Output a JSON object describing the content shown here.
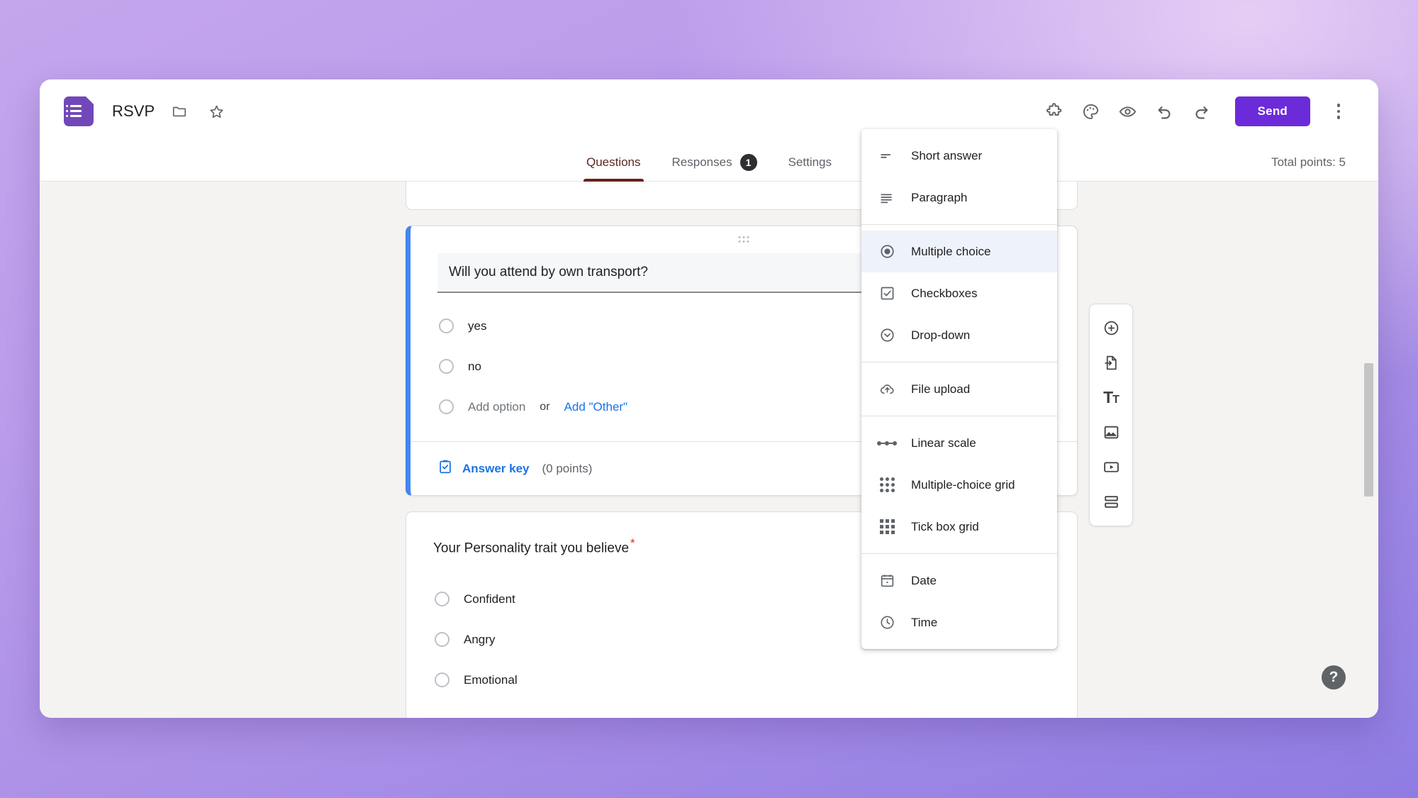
{
  "app": {
    "logo_icon": "google-forms-icon",
    "doc_title": "RSVP",
    "folder_icon": "folder-move-icon",
    "star_icon": "star-outline-icon"
  },
  "toolbar": {
    "addons_icon": "puzzle-piece-icon",
    "theme_icon": "palette-icon",
    "preview_icon": "eye-preview-icon",
    "undo_icon": "undo-icon",
    "redo_icon": "redo-icon",
    "send_label": "Send",
    "more_icon": "kebab-more-icon",
    "accent_color": "#6c2bd9"
  },
  "tabs": {
    "items": [
      {
        "label": "Questions",
        "active": true
      },
      {
        "label": "Responses",
        "badge": "1",
        "active": false
      },
      {
        "label": "Settings",
        "active": false
      }
    ],
    "questions_label": "Questions",
    "responses_label": "Responses",
    "responses_badge": "1",
    "settings_label": "Settings",
    "total_points": "Total points: 5",
    "active_underline_color": "#6d1f1a"
  },
  "question1": {
    "title": "Will you attend by own transport?",
    "image_icon": "add-image-icon",
    "drag_handle_icon": "drag-handle-icon",
    "options": [
      {
        "label": "yes"
      },
      {
        "label": "no"
      }
    ],
    "add_option_label": "Add option",
    "or_label": "or",
    "add_other_label": "Add \"Other\"",
    "answer_key_label": "Answer key",
    "answer_key_icon": "clipboard-check-icon",
    "points_label": "(0 points)",
    "duplicate_icon": "duplicate-icon",
    "accent_border_color": "#4285f4"
  },
  "question2": {
    "title": "Your Personality trait you believe",
    "required_marker": "*",
    "options": [
      {
        "label": "Confident"
      },
      {
        "label": "Angry"
      },
      {
        "label": "Emotional"
      }
    ]
  },
  "side_toolbar": {
    "items": [
      {
        "name": "add-question",
        "icon": "plus-circle-icon"
      },
      {
        "name": "import-questions",
        "icon": "import-file-icon"
      },
      {
        "name": "add-title-description",
        "icon": "text-title-icon",
        "glyph": "T",
        "glyph_small": "T"
      },
      {
        "name": "add-image",
        "icon": "image-icon"
      },
      {
        "name": "add-video",
        "icon": "video-play-icon"
      },
      {
        "name": "add-section",
        "icon": "section-split-icon"
      }
    ]
  },
  "type_menu": {
    "groups": [
      {
        "items": [
          {
            "label": "Short answer",
            "icon": "short-answer-icon",
            "selected": false
          },
          {
            "label": "Paragraph",
            "icon": "paragraph-icon",
            "selected": false
          }
        ]
      },
      {
        "items": [
          {
            "label": "Multiple choice",
            "icon": "radio-selected-icon",
            "selected": true
          },
          {
            "label": "Checkboxes",
            "icon": "checkbox-icon",
            "selected": false
          },
          {
            "label": "Drop-down",
            "icon": "chevron-down-circle-icon",
            "selected": false
          }
        ]
      },
      {
        "items": [
          {
            "label": "File upload",
            "icon": "cloud-upload-icon",
            "selected": false
          }
        ]
      },
      {
        "items": [
          {
            "label": "Linear scale",
            "icon": "linear-scale-icon",
            "selected": false
          },
          {
            "label": "Multiple-choice grid",
            "icon": "dot-grid-icon",
            "selected": false
          },
          {
            "label": "Tick box grid",
            "icon": "square-grid-icon",
            "selected": false
          }
        ]
      },
      {
        "items": [
          {
            "label": "Date",
            "icon": "calendar-icon",
            "selected": false
          },
          {
            "label": "Time",
            "icon": "clock-icon",
            "selected": false
          }
        ]
      }
    ],
    "selected_highlight_color": "#eef3fb"
  },
  "help": {
    "label": "?",
    "icon": "help-question-icon"
  },
  "scrollbar": {
    "orientation": "vertical"
  }
}
